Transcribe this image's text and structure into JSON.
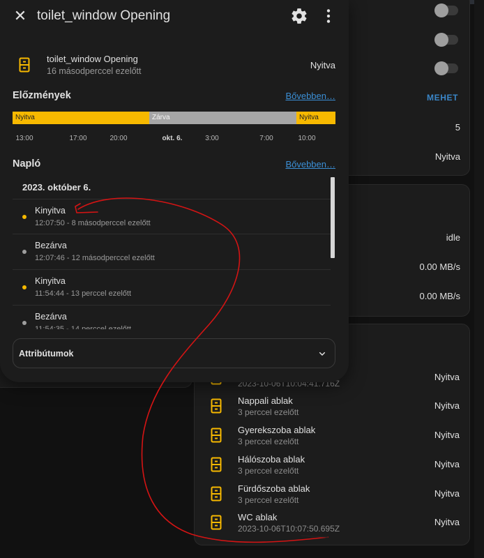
{
  "colors": {
    "accent": "#f7b900",
    "link": "#3b8fd6",
    "closed": "#a6a6a6",
    "annotation": "#d41414"
  },
  "dialog": {
    "title": "toilet_window Opening",
    "icons": {
      "close": "close-icon",
      "settings": "gear-icon",
      "more": "dots-vertical-icon"
    },
    "state": {
      "name": "toilet_window Opening",
      "last_changed": "16 másodperccel ezelőtt",
      "value": "Nyitva"
    },
    "history": {
      "heading": "Előzmények",
      "more_link": "Bővebben…",
      "segments": [
        {
          "label": "Nyitva",
          "state": "open"
        },
        {
          "label": "Zárva",
          "state": "closed"
        },
        {
          "label": "Nyitva",
          "state": "open"
        }
      ],
      "axis": [
        "13:00",
        "17:00",
        "20:00",
        "okt. 6.",
        "3:00",
        "7:00",
        "10:00"
      ]
    },
    "logbook": {
      "heading": "Napló",
      "more_link": "Bővebben…",
      "date": "2023. október 6.",
      "entries": [
        {
          "title": "Kinyitva",
          "detail": "12:07:50 - 8 másodperccel ezelőtt",
          "dot": "#f7b900"
        },
        {
          "title": "Bezárva",
          "detail": "12:07:46 - 12 másodperccel ezelőtt",
          "dot": "#9e9e9e"
        },
        {
          "title": "Kinyitva",
          "detail": "11:54:44 - 13 perccel ezelőtt",
          "dot": "#f7b900"
        },
        {
          "title": "Bezárva",
          "detail": "11:54:35 - 14 perccel ezelőtt",
          "dot": "#9e9e9e"
        }
      ]
    },
    "attributes": {
      "label": "Attribútumok"
    }
  },
  "background": {
    "card1": {
      "button": "MEHET",
      "count": "5",
      "state": "Nyitva"
    },
    "card2": {
      "status": "idle",
      "rate1": "0.00 MB/s",
      "rate2": "0.00 MB/s"
    },
    "card3": {
      "entities": [
        {
          "name": "",
          "secondary": "2023-10-06T10:04:41.716Z",
          "state": "Nyitva"
        },
        {
          "name": "Nappali ablak",
          "secondary": "3 perccel ezelőtt",
          "state": "Nyitva"
        },
        {
          "name": "Gyerekszoba ablak",
          "secondary": "3 perccel ezelőtt",
          "state": "Nyitva"
        },
        {
          "name": "Hálószoba ablak",
          "secondary": "3 perccel ezelőtt",
          "state": "Nyitva"
        },
        {
          "name": "Fürdőszoba ablak",
          "secondary": "3 perccel ezelőtt",
          "state": "Nyitva"
        },
        {
          "name": "WC ablak",
          "secondary": "2023-10-06T10:07:50.695Z",
          "state": "Nyitva"
        }
      ]
    }
  }
}
